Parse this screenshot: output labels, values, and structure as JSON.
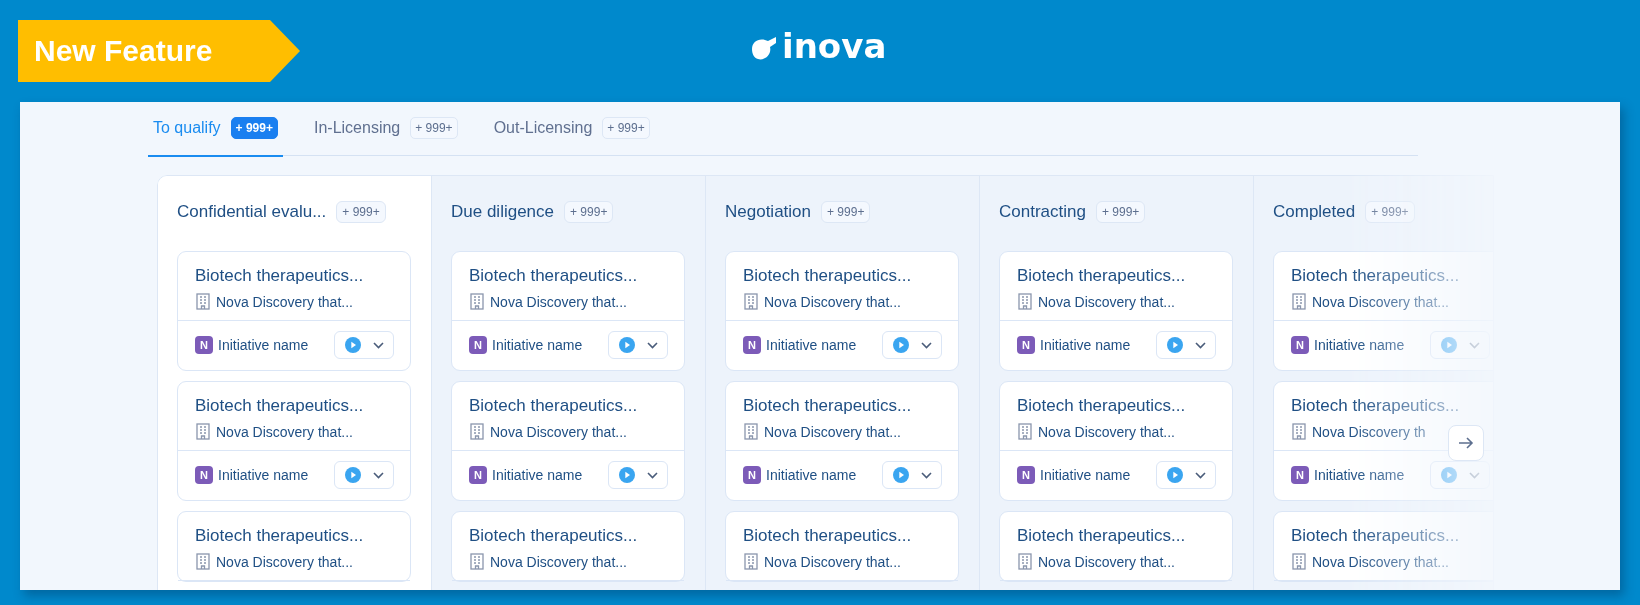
{
  "banner": {
    "label": "New Feature"
  },
  "logo": {
    "text": "inova"
  },
  "tabs": [
    {
      "label": "To qualify",
      "count": "+ 999+",
      "selected": true
    },
    {
      "label": "In-Licensing",
      "count": "+ 999+",
      "selected": false
    },
    {
      "label": "Out-Licensing",
      "count": "+ 999+",
      "selected": false
    }
  ],
  "columns": [
    {
      "title": "Confidential evalu...",
      "count": "+ 999+",
      "selected": true,
      "cards": [
        {
          "title": "Biotech therapeutics...",
          "company": "Nova Discovery that...",
          "initiative_badge": "N",
          "initiative": "Initiative name"
        },
        {
          "title": "Biotech therapeutics...",
          "company": "Nova Discovery that...",
          "initiative_badge": "N",
          "initiative": "Initiative name"
        },
        {
          "title": "Biotech therapeutics...",
          "company": "Nova Discovery that..."
        }
      ]
    },
    {
      "title": "Due diligence",
      "count": "+ 999+",
      "selected": false,
      "cards": [
        {
          "title": "Biotech therapeutics...",
          "company": "Nova Discovery that...",
          "initiative_badge": "N",
          "initiative": "Initiative name"
        },
        {
          "title": "Biotech therapeutics...",
          "company": "Nova Discovery that...",
          "initiative_badge": "N",
          "initiative": "Initiative name"
        },
        {
          "title": "Biotech therapeutics...",
          "company": "Nova Discovery that..."
        }
      ]
    },
    {
      "title": "Negotiation",
      "count": "+ 999+",
      "selected": false,
      "cards": [
        {
          "title": "Biotech therapeutics...",
          "company": "Nova Discovery that...",
          "initiative_badge": "N",
          "initiative": "Initiative name"
        },
        {
          "title": "Biotech therapeutics...",
          "company": "Nova Discovery that...",
          "initiative_badge": "N",
          "initiative": "Initiative name"
        },
        {
          "title": "Biotech therapeutics...",
          "company": "Nova Discovery that..."
        }
      ]
    },
    {
      "title": "Contracting",
      "count": "+ 999+",
      "selected": false,
      "cards": [
        {
          "title": "Biotech therapeutics...",
          "company": "Nova Discovery that...",
          "initiative_badge": "N",
          "initiative": "Initiative name"
        },
        {
          "title": "Biotech therapeutics...",
          "company": "Nova Discovery that...",
          "initiative_badge": "N",
          "initiative": "Initiative name"
        },
        {
          "title": "Biotech therapeutics...",
          "company": "Nova Discovery that..."
        }
      ]
    },
    {
      "title": "Completed",
      "count": "+ 999+",
      "selected": false,
      "cards": [
        {
          "title": "Biotech therapeutics...",
          "company": "Nova Discovery that...",
          "initiative_badge": "N",
          "initiative": "Initiative name"
        },
        {
          "title": "Biotech therapeutics...",
          "company": "Nova Discovery th",
          "initiative_badge": "N",
          "initiative": "Initiative name"
        },
        {
          "title": "Biotech therapeutics...",
          "company": "Nova Discovery that..."
        }
      ]
    }
  ]
}
